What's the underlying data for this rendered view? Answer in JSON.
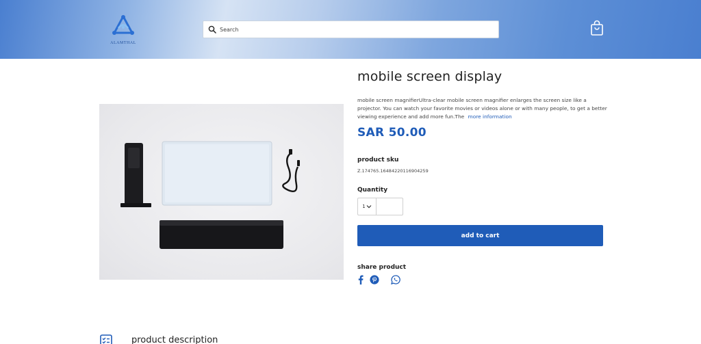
{
  "header": {
    "logo_text": "ALAMTHAL",
    "search": {
      "placeholder": "Search",
      "value": ""
    },
    "icons": {
      "search": "search-icon",
      "cart": "shopping-bag-icon"
    }
  },
  "product": {
    "title": "mobile screen display",
    "description": "mobile screen magnifierUltra-clear mobile screen magnifier enlarges the screen size like a projector. You can watch your favorite movies or videos alone or with many people, to get a better viewing experience and add more fun.The",
    "more_link": "more information",
    "price": "SAR 50.00",
    "sku_label": "product sku",
    "sku_value": "Z.174765.16484220116904259",
    "quantity_label": "Quantity",
    "quantity_value": "1",
    "add_to_cart": "add to cart",
    "share_label": "share product",
    "share_icons": [
      "facebook-icon",
      "pinterest-icon",
      "whatsapp-icon"
    ]
  },
  "sections": {
    "description_heading": "product description"
  },
  "colors": {
    "accent": "#1f5cb8",
    "header_gradient_start": "#4a7fd0",
    "header_gradient_light": "#d6e3f4"
  }
}
